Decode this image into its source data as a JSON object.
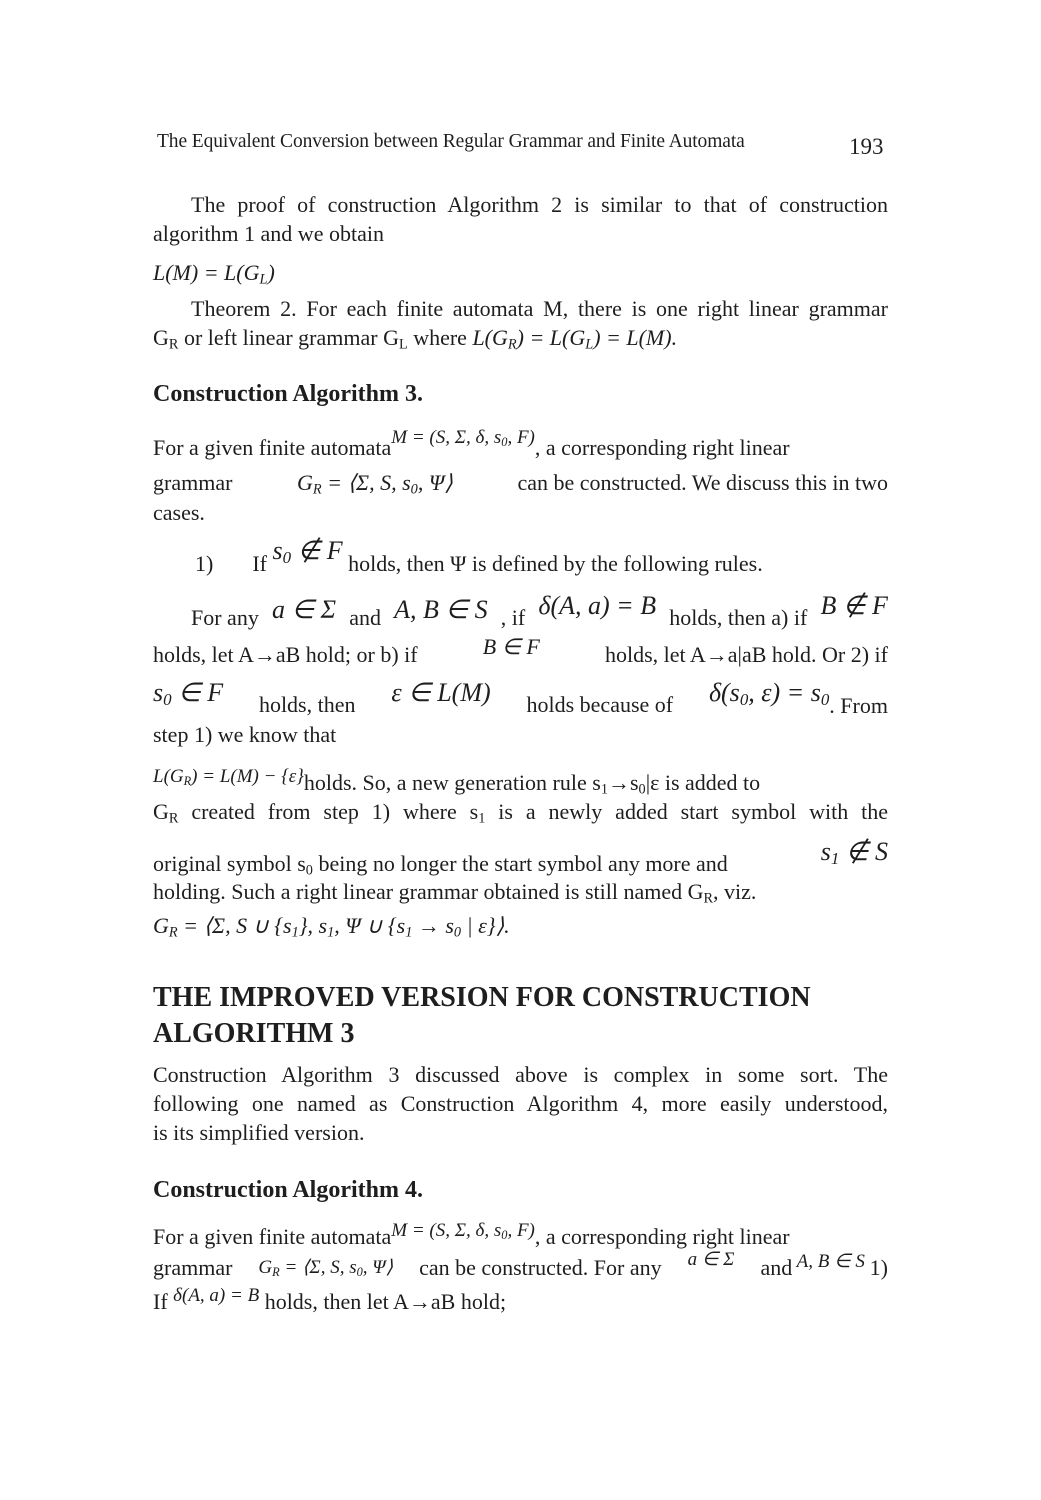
{
  "header": {
    "running_title": "The Equivalent Conversion between Regular Grammar and Finite Automata",
    "page_number": "193"
  },
  "p1": {
    "line1": "The proof of construction Algorithm 2 is similar to that of construction",
    "line2": "algorithm 1 and we obtain",
    "eq": "L(M) = L(G_L)"
  },
  "theorem2": {
    "line1": "Theorem 2. For each finite automata M, there is one right linear grammar",
    "line2_a": "G",
    "line2_a_sub": "R",
    "line2_b": " or left linear grammar G",
    "line2_b_sub": "L",
    "line2_c": " where ",
    "eq": "L(G_R) = L(G_L) = L(M)."
  },
  "alg3": {
    "heading": "Construction Algorithm 3.",
    "l1_a": "For a given finite automata",
    "l1_eq": "M = (S, Σ, δ, s0, F)",
    "l1_b": ", a corresponding right linear",
    "l2_a": "grammar",
    "l2_eq": "G_R = ⟨Σ, S, s0, Ψ⟩",
    "l2_b": "can be constructed. We discuss this in two",
    "l3": "cases.",
    "case1_num": "1)",
    "case1_a": "If",
    "case1_eq": "s0 ∉ F",
    "case1_b": "holds, then Ψ is defined by the following rules.",
    "r1_a": "For any",
    "r1_eq1": "a ∈ Σ",
    "r1_b": "and",
    "r1_eq2": "A, B ∈ S",
    "r1_c": ", if",
    "r1_eq3": "δ(A, a) = B",
    "r1_d": "holds, then a) if",
    "r1_eq4": "B ∉ F",
    "r2_a": "holds, let A→aB hold; or b) if",
    "r2_eq": "B ∈ F",
    "r2_b": "holds, let A→a|aB hold. Or 2) if",
    "r3_eq1": "s0 ∈ F",
    "r3_a": "holds, then",
    "r3_eq2": "ε ∈ L(M)",
    "r3_b": "holds because of",
    "r3_eq3": "δ(s0, ε) = s0",
    "r3_c": ". From",
    "r4": "step 1) we know that",
    "r5_eq": "L(G_R) = L(M) − {ε}",
    "r5_a": "holds. So, a new generation rule s",
    "r5_b": "→s",
    "r5_c": "|ε is added to",
    "r6_a": "G",
    "r6_b": " created from step 1) where s",
    "r6_c": " is a newly added start symbol with the",
    "r7_a": "original symbol s",
    "r7_b": " being no longer the start symbol any more and",
    "r7_eq": "s1 ∉ S",
    "r8_a": "holding. Such a right linear grammar obtained is still named G",
    "r8_b": ", viz.",
    "r9_eq": "G_R = ⟨Σ, S ∪ {s1}, s1, Ψ ∪ {s1 → s0 | ε}⟩."
  },
  "improved": {
    "heading_line1": "THE IMPROVED VERSION FOR CONSTRUCTION",
    "heading_line2": "ALGORITHM 3",
    "l1": "Construction Algorithm 3 discussed above is complex in some sort. The",
    "l2": "following one named as Construction Algorithm 4, more easily understood,",
    "l3": "is its simplified version."
  },
  "alg4": {
    "heading": "Construction Algorithm 4.",
    "l1_a": "For a given finite automata",
    "l1_eq": "M = (S, Σ, δ, s0, F)",
    "l1_b": ", a corresponding right linear",
    "l2_a": "grammar",
    "l2_eq": "G_R = ⟨Σ, S, s0, Ψ⟩",
    "l2_b": "can be constructed. For any",
    "l2_eq2": "a ∈ Σ",
    "l2_c": "and",
    "l2_eq3": "A, B ∈ S",
    "l2_d": "1)",
    "l3_a": "If",
    "l3_eq": "δ(A, a) = B",
    "l3_b": "holds, then let A→aB hold;"
  }
}
